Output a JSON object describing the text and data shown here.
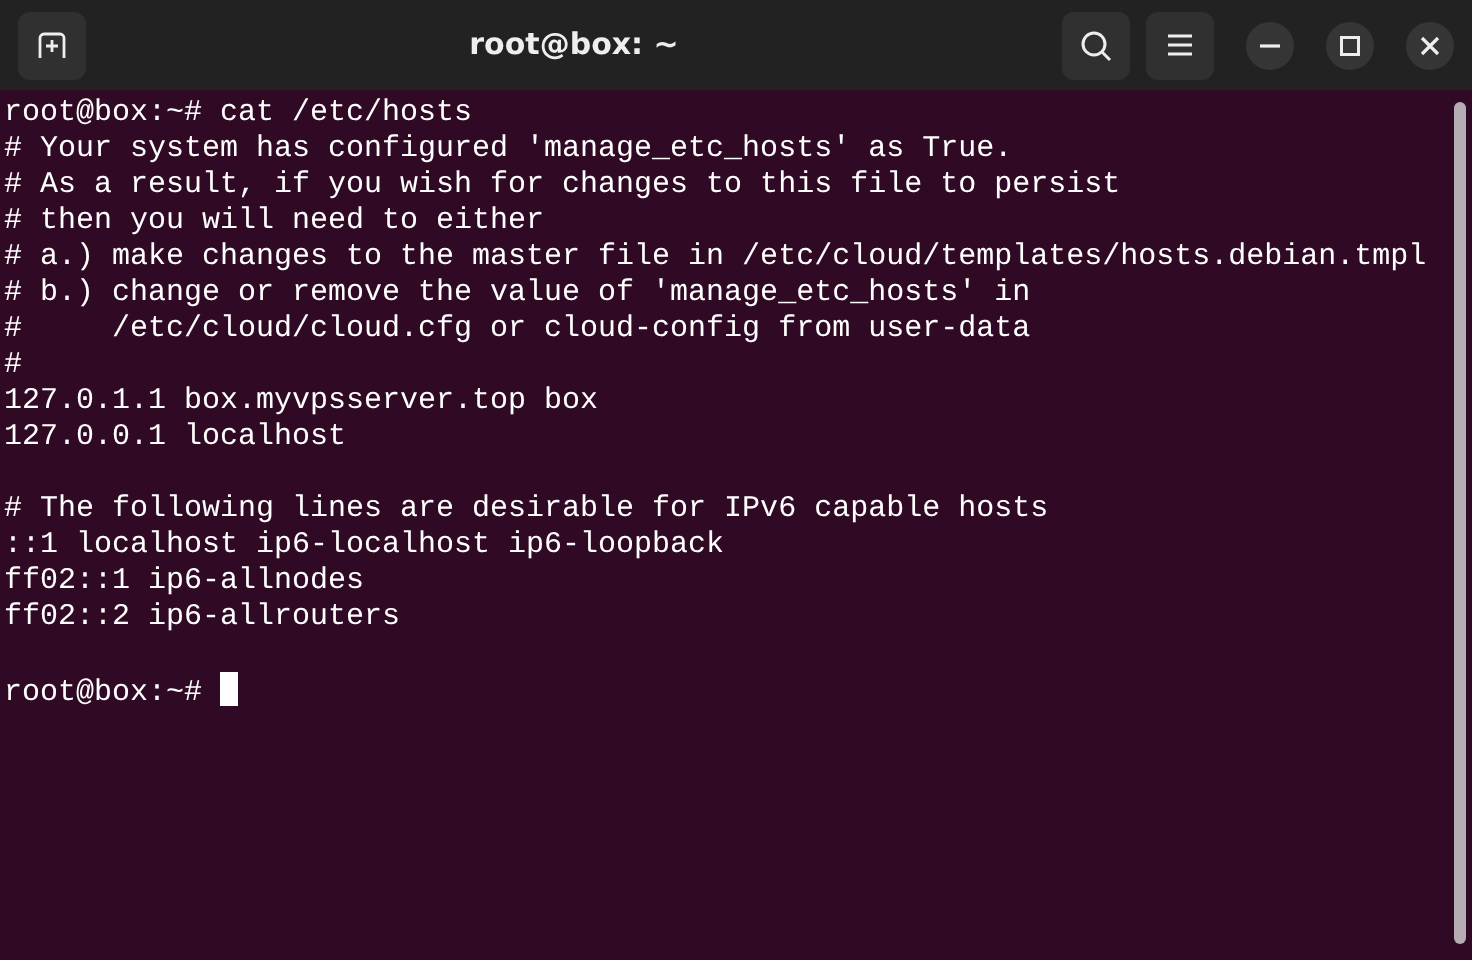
{
  "window": {
    "title": "root@box: ~"
  },
  "terminal": {
    "blocks": [
      [
        "root@box:~# cat /etc/hosts",
        "# Your system has configured 'manage_etc_hosts' as True.",
        "# As a result, if you wish for changes to this file to persist",
        "# then you will need to either",
        "# a.) make changes to the master file in /etc/cloud/templates/hosts.debian.tmpl",
        "# b.) change or remove the value of 'manage_etc_hosts' in",
        "#     /etc/cloud/cloud.cfg or cloud-config from user-data",
        "#",
        "127.0.1.1 box.myvpsserver.top box",
        "127.0.0.1 localhost"
      ],
      [
        "# The following lines are desirable for IPv6 capable hosts",
        "::1 localhost ip6-localhost ip6-loopback",
        "ff02::1 ip6-allnodes",
        "ff02::2 ip6-allrouters"
      ],
      [
        "root@box:~#"
      ]
    ],
    "cursor": true
  }
}
